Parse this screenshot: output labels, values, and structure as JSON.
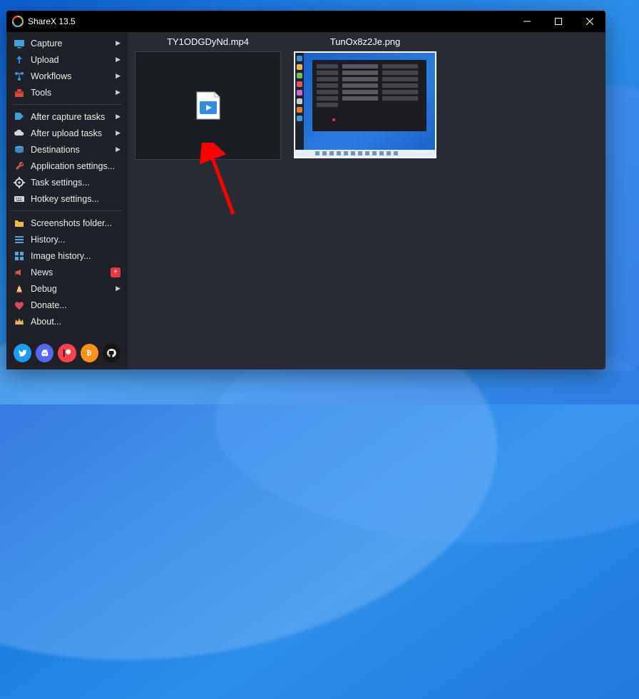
{
  "window": {
    "title": "ShareX 13.5"
  },
  "sidebar": {
    "groups": [
      [
        {
          "key": "capture",
          "label": "Capture",
          "submenu": true
        },
        {
          "key": "upload",
          "label": "Upload",
          "submenu": true
        },
        {
          "key": "workflows",
          "label": "Workflows",
          "submenu": true
        },
        {
          "key": "tools",
          "label": "Tools",
          "submenu": true
        }
      ],
      [
        {
          "key": "after-capture",
          "label": "After capture tasks",
          "submenu": true
        },
        {
          "key": "after-upload",
          "label": "After upload tasks",
          "submenu": true
        },
        {
          "key": "destinations",
          "label": "Destinations",
          "submenu": true
        },
        {
          "key": "app-settings",
          "label": "Application settings...",
          "submenu": false
        },
        {
          "key": "task-settings",
          "label": "Task settings...",
          "submenu": false
        },
        {
          "key": "hotkey-settings",
          "label": "Hotkey settings...",
          "submenu": false
        }
      ],
      [
        {
          "key": "screenshots-folder",
          "label": "Screenshots folder...",
          "submenu": false
        },
        {
          "key": "history",
          "label": "History...",
          "submenu": false
        },
        {
          "key": "image-history",
          "label": "Image history...",
          "submenu": false
        },
        {
          "key": "news",
          "label": "News",
          "submenu": false,
          "badge": "+"
        },
        {
          "key": "debug",
          "label": "Debug",
          "submenu": true
        },
        {
          "key": "donate",
          "label": "Donate...",
          "submenu": false
        },
        {
          "key": "about",
          "label": "About...",
          "submenu": false
        }
      ]
    ]
  },
  "social": [
    {
      "key": "twitter",
      "color": "#1d9bf0"
    },
    {
      "key": "discord",
      "color": "#5865f2"
    },
    {
      "key": "patreon",
      "color": "#ff424d"
    },
    {
      "key": "bitcoin",
      "color": "#f7931a"
    },
    {
      "key": "github",
      "color": "#171515"
    }
  ],
  "files": [
    {
      "name": "TY1ODGDyNd.mp4",
      "type": "video"
    },
    {
      "name": "TunOx8z2Je.png",
      "type": "image"
    }
  ],
  "annotation": {
    "type": "arrow",
    "color": "#ff0000"
  }
}
